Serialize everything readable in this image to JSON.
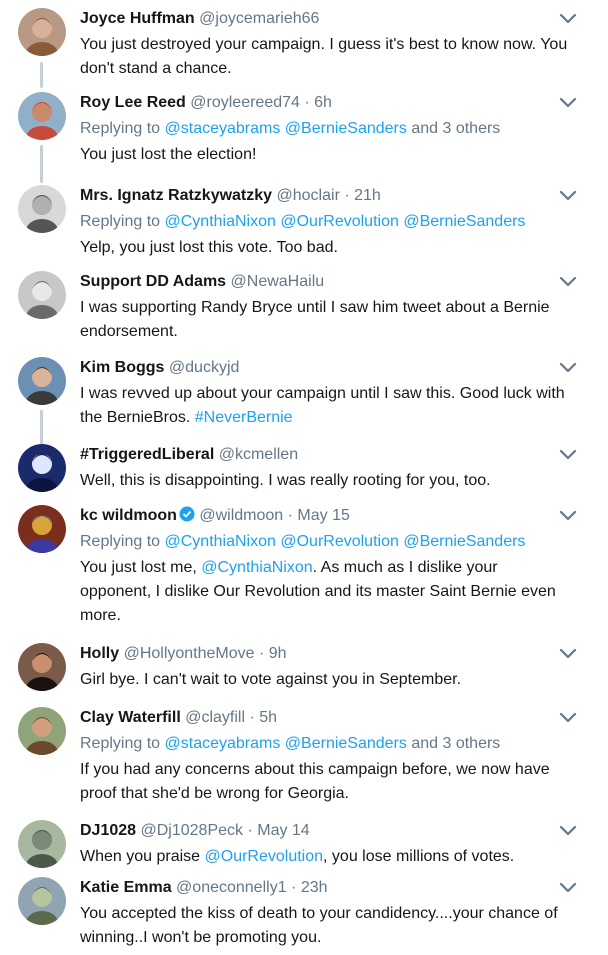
{
  "tweets": [
    {
      "name": "Joyce Huffman",
      "handle": "@joycemarieh66",
      "time": "",
      "replying": null,
      "text": [
        {
          "t": "You just destroyed your campaign. I guess it's best to know now. You don't stand a chance."
        }
      ]
    },
    {
      "name": "Roy Lee Reed",
      "handle": "@royleereed74",
      "time": " · 6h",
      "replying": {
        "prefix": "Replying to ",
        "mentions": [
          "@staceyabrams",
          "@BernieSanders"
        ],
        "suffix": " and 3 others"
      },
      "text": [
        {
          "t": "You just lost the election!"
        }
      ]
    },
    {
      "name": "Mrs. Ignatz Ratzkywatzky",
      "handle": "@hoclair",
      "time": " · 21h",
      "replying": {
        "prefix": "Replying to ",
        "mentions": [
          "@CynthiaNixon",
          "@OurRevolution",
          "@BernieSanders"
        ],
        "suffix": ""
      },
      "text": [
        {
          "t": "Yelp, you just lost this vote. Too bad."
        }
      ]
    },
    {
      "name": "Support DD Adams",
      "handle": "@NewaHailu",
      "time": "",
      "replying": null,
      "text": [
        {
          "t": "I was supporting Randy Bryce until I saw him tweet about a Bernie endorsement."
        }
      ]
    },
    {
      "name": "Kim Boggs",
      "handle": "@duckyjd",
      "time": "",
      "replying": null,
      "text": [
        {
          "t": "I was revved up about your campaign until I saw this.  Good luck with the BernieBros. "
        },
        {
          "t": "#NeverBernie",
          "link": true
        }
      ]
    },
    {
      "name": "#TriggeredLiberal",
      "handle": "@kcmellen",
      "time": "",
      "replying": null,
      "text": [
        {
          "t": "Well, this is disappointing. I was really rooting for you, too."
        }
      ]
    },
    {
      "name": "kc wildmoon",
      "handle": "@wildmoon",
      "time": " · May 15",
      "verified": true,
      "replying": {
        "prefix": "Replying to ",
        "mentions": [
          "@CynthiaNixon",
          "@OurRevolution",
          "@BernieSanders"
        ],
        "suffix": ""
      },
      "text": [
        {
          "t": "You just lost me, "
        },
        {
          "t": "@CynthiaNixon",
          "link": true
        },
        {
          "t": ". As much as I dislike your opponent, I dislike Our Revolution and its master Saint Bernie even more."
        }
      ]
    },
    {
      "name": "Holly",
      "handle": "@HollyontheMove",
      "time": " · 9h",
      "replying": null,
      "text": [
        {
          "t": "Girl bye. I can't wait to vote against you in September."
        }
      ]
    },
    {
      "name": "Clay Waterfill",
      "handle": "@clayfill",
      "time": " · 5h",
      "replying": {
        "prefix": "Replying to ",
        "mentions": [
          "@staceyabrams",
          "@BernieSanders"
        ],
        "suffix": " and 3 others"
      },
      "text": [
        {
          "t": "If you had any concerns about this campaign before, we now have proof that she'd be wrong for Georgia."
        }
      ]
    },
    {
      "name": "DJ1028",
      "handle": "@Dj1028Peck",
      "time": " · May 14",
      "replying": null,
      "text": [
        {
          "t": "When you praise "
        },
        {
          "t": "@OurRevolution",
          "link": true
        },
        {
          "t": ", you lose millions of votes."
        }
      ]
    },
    {
      "name": "Katie Emma",
      "handle": "@oneconnelly1",
      "time": " · 23h",
      "replying": null,
      "text": [
        {
          "t": "You accepted the kiss of death to your candidency....your chance of winning..I won't be promoting you."
        }
      ]
    }
  ],
  "colors": {
    "link": "#1da1f2",
    "secondary": "#657786",
    "thread_line": "#c4cfd6"
  },
  "icons": {
    "menu": "chevron-down-icon",
    "verified": "verified-badge-icon"
  }
}
